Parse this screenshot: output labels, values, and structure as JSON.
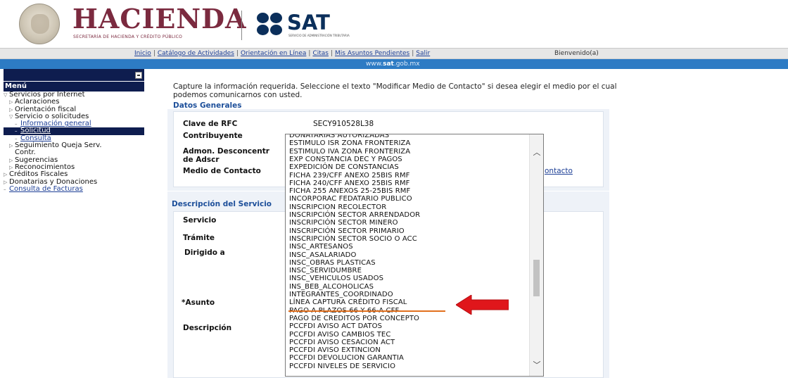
{
  "header": {
    "title": "HACIENDA",
    "subtitle": "SECRETARÍA DE HACIENDA Y CRÉDITO PÚBLICO",
    "sat_title": "SAT",
    "sat_subtitle": "SERVICIO DE ADMINISTRACIÓN TRIBUTARIA"
  },
  "topnav": {
    "links": [
      "Inicio",
      "Catálogo de Actividades",
      "Orientación en Línea",
      "Citas",
      "Mis Asuntos Pendientes",
      "Salir"
    ],
    "welcome": "Bienvenido(a)"
  },
  "band": {
    "url_prefix": "www.",
    "url_bold": "sat",
    "url_suffix": ".gob.mx"
  },
  "sidebar": {
    "menu_label": "Menú",
    "items": [
      {
        "label": "Servicios por Internet",
        "arrow": "▽"
      },
      {
        "label": "Aclaraciones",
        "arrow": "▷"
      },
      {
        "label": "Orientación fiscal",
        "arrow": "▷"
      },
      {
        "label": "Servicio o solicitudes",
        "arrow": "▽"
      },
      {
        "label": "Información general",
        "arrow": "–"
      },
      {
        "label": "Solicitud",
        "arrow": "–"
      },
      {
        "label": "Consulta",
        "arrow": "–"
      },
      {
        "label": "Seguimiento Queja Serv.",
        "arrow": "▷"
      },
      {
        "label": "Contr."
      },
      {
        "label": "Sugerencias",
        "arrow": "▷"
      },
      {
        "label": "Reconocimientos",
        "arrow": "▷"
      },
      {
        "label": "Créditos Fiscales",
        "arrow": "▷"
      },
      {
        "label": "Donatarias y Donaciones",
        "arrow": "▷"
      },
      {
        "label": "Consulta de Facturas",
        "arrow": "–"
      }
    ]
  },
  "main": {
    "intro": "Capture la información requerida. Seleccione el texto \"Modificar Medio de Contacto\" si desea elegir el medio por el cual podemos comunicarnos con usted.",
    "datos_generales": {
      "title": "Datos Generales",
      "rfc_label": "Clave de RFC",
      "rfc_value": "SECY910528L38",
      "contribuyente_label": "Contribuyente",
      "admon_label_1": "Admon. Desconcentr",
      "admon_label_2": "de Adscr",
      "medio_label": "Medio de Contacto",
      "medio_link": "ontacto"
    },
    "descripcion": {
      "title": "Descripción del Servicio",
      "servicio_label": "Servicio",
      "tramite_label": "Trámite",
      "dirigido_label": "Dirigido a",
      "asunto_label": "*Asunto",
      "descripcion_label": "Descripción"
    }
  },
  "dropdown": {
    "options": [
      "DONATARIAS AUTORIZADAS",
      "ESTIMULO ISR ZONA FRONTERIZA",
      "ESTIMULO IVA ZONA FRONTERIZA",
      "EXP CONSTANCIA DEC Y PAGOS",
      "EXPEDICIÓN DE CONSTANCIAS",
      "FICHA 239/CFF ANEXO 25BIS RMF",
      "FICHA 240/CFF ANEXO 25BIS RMF",
      "FICHA 255 ANEXOS 25-25BIS RMF",
      "INCORPORAC FEDATARIO PUBLICO",
      "INSCRIPCION RECOLECTOR",
      "INSCRIPCIÓN SECTOR ARRENDADOR",
      "INSCRIPCIÓN SECTOR MINERO",
      "INSCRIPCIÓN SECTOR PRIMARIO",
      "INSCRIPCIÓN SECTOR SOCIO O ACC",
      "INSC_ARTESANOS",
      "INSC_ASALARIADO",
      "INSC_OBRAS PLASTICAS",
      "INSC_SERVIDUMBRE",
      "INSC_VEHICULOS USADOS",
      "INS_BEB_ALCOHOLICAS",
      "INTEGRANTES_COORDINADO",
      "LÍNEA CAPTURA CRÉDITO FISCAL",
      "PAGO A PLAZOS 66 Y 66-A CFF",
      "PAGO DE CREDITOS POR CONCEPTO",
      "PCCFDI AVISO ACT DATOS",
      "PCCFDI AVISO CAMBIOS TEC",
      "PCCFDI AVISO CESACION ACT",
      "PCCFDI AVISO EXTINCION",
      "PCCFDI DEVOLUCION GARANTIA",
      "PCCFDI NIVELES DE SERVICIO"
    ],
    "highlighted": "LÍNEA CAPTURA CRÉDITO FISCAL",
    "highlight_color": "#e2701e",
    "arrow_color": "#e0161b"
  }
}
